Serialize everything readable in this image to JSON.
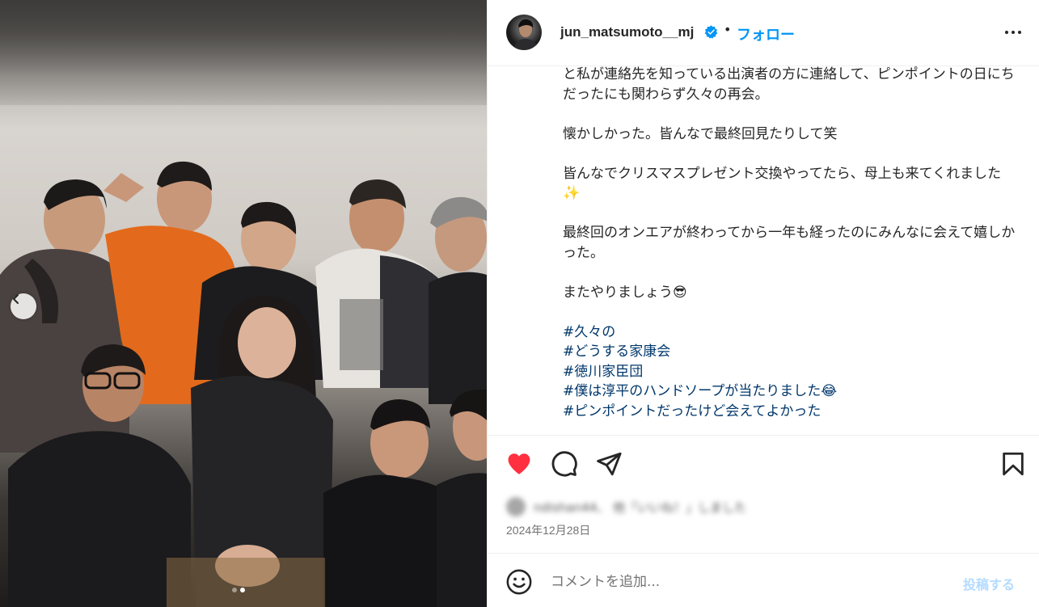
{
  "post": {
    "author": {
      "username": "jun_matsumoto__mj",
      "verified": true,
      "separator": "•",
      "follow_label": "フォロー",
      "avatar_icon": "avatar-photo"
    },
    "caption": {
      "paragraphs": [
        "と私が連絡先を知っている出演者の方に連絡して、ピンポイントの日にちだったにも関わらず久々の再会。",
        "懐かしかった。皆んなで最終回見たりして笑",
        "皆んなでクリスマスプレゼント交換やってたら、母上も来てくれました✨",
        "最終回のオンエアが終わってから一年も経ったのにみんなに会えて嬉しかった。",
        "またやりましょう😎"
      ],
      "hashtags": [
        "#久々の",
        "#どうする家康会",
        "#徳川家臣団",
        "#僕は淳平のハンドソープが当たりました😂",
        "#ピンポイントだったけど会えてよかった"
      ]
    },
    "actions": {
      "like_icon": "heart-filled-icon",
      "comment_icon": "comment-icon",
      "share_icon": "share-icon",
      "save_icon": "bookmark-icon",
      "like_color": "#ff3040"
    },
    "likes_blurred_text": "ndishan44、 他「いいね！」しました",
    "date": "2024年12月28日",
    "comment_bar": {
      "placeholder": "コメントを追加...",
      "post_label": "投稿する"
    },
    "carousel": {
      "current_index": 2,
      "total": 2
    }
  },
  "colors": {
    "link_blue": "#0095f6",
    "hashtag_blue": "#00376b",
    "post_disabled": "#b3dbff"
  }
}
